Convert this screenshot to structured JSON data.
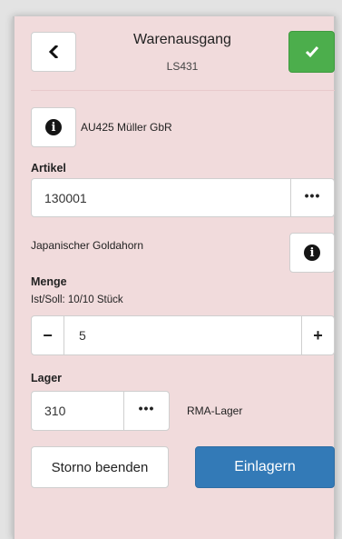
{
  "header": {
    "back_icon": "chevron-left-icon",
    "title": "Warenausgang",
    "subtitle": "LS431",
    "confirm_icon": "check-icon",
    "confirm_color": "#4cae4c"
  },
  "order": {
    "info_icon": "info-circle-icon",
    "text": "AU425 Müller GbR"
  },
  "artikel": {
    "label": "Artikel",
    "value": "130001",
    "more_label": "•••",
    "description": "Japanischer Goldahorn"
  },
  "menge": {
    "label": "Menge",
    "status": "Ist/Soll: 10/10 Stück",
    "minus_label": "−",
    "value": "5",
    "plus_label": "+"
  },
  "lager": {
    "label": "Lager",
    "value": "310",
    "more_label": "•••",
    "name": "RMA-Lager"
  },
  "actions": {
    "storno_label": "Storno beenden",
    "einlagern_label": "Einlagern",
    "einlagern_color": "#337ab7"
  }
}
